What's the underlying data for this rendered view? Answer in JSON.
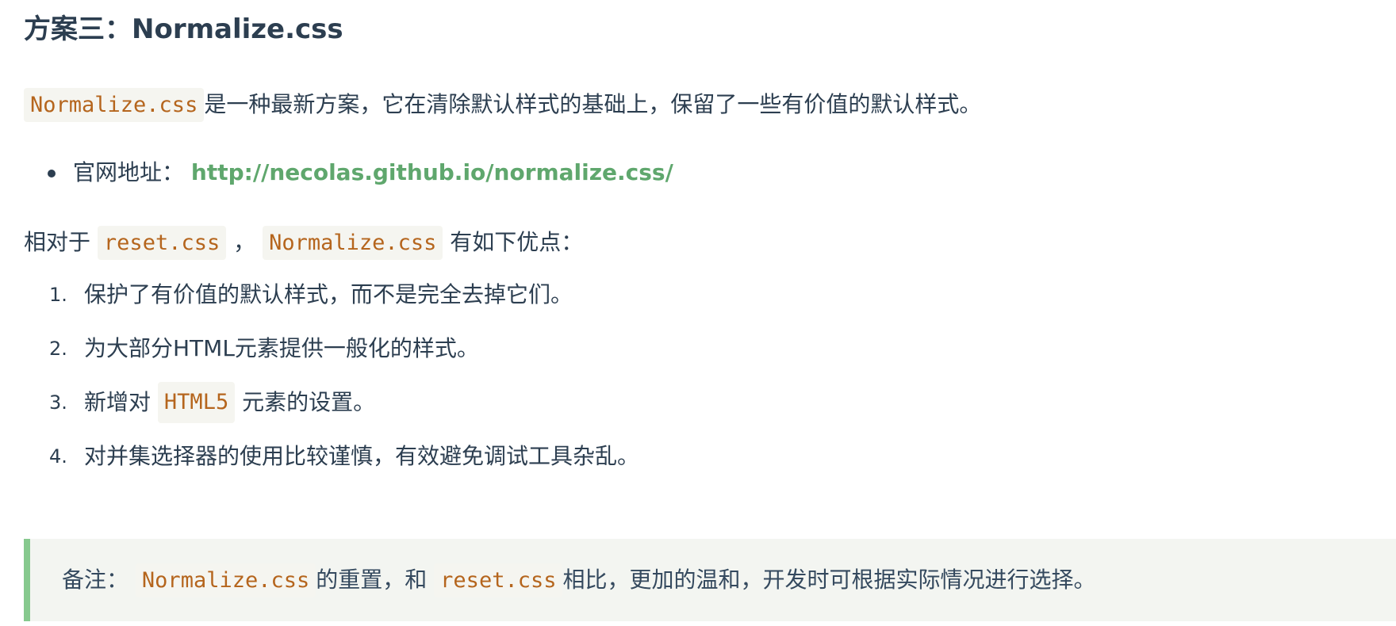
{
  "heading": {
    "prefix": "方案三：",
    "name": "Normalize.css"
  },
  "intro": {
    "code": "Normalize.css",
    "text": "是一种最新方案，它在清除默认样式的基础上，保留了一些有价值的默认样式。"
  },
  "bullets": [
    {
      "label": "官网地址：",
      "link": "http://necolas.github.io/normalize.css/"
    }
  ],
  "compare": {
    "text_before": "相对于",
    "code1": "reset.css",
    "sep": "，",
    "code2": "Normalize.css",
    "text_after": "有如下优点："
  },
  "advantages": [
    {
      "num": "1.",
      "text": "保护了有价值的默认样式，而不是完全去掉它们。"
    },
    {
      "num": "2.",
      "text": "为大部分HTML元素提供一般化的样式。"
    },
    {
      "num": "3.",
      "text_before": "新增对",
      "code": "HTML5",
      "text_after": "元素的设置。"
    },
    {
      "num": "4.",
      "text": "对并集选择器的使用比较谨慎，有效避免调试工具杂乱。"
    }
  ],
  "note": {
    "label": "备注：",
    "code1": "Normalize.css",
    "mid": "的重置，和",
    "code2": "reset.css",
    "end": "相比，更加的温和，开发时可根据实际情况进行选择。"
  },
  "colors": {
    "text": "#2c3e50",
    "code": "#b5651d",
    "link": "#5fa76d",
    "note_border": "#86c98e",
    "note_bg": "#f3f5f1"
  }
}
